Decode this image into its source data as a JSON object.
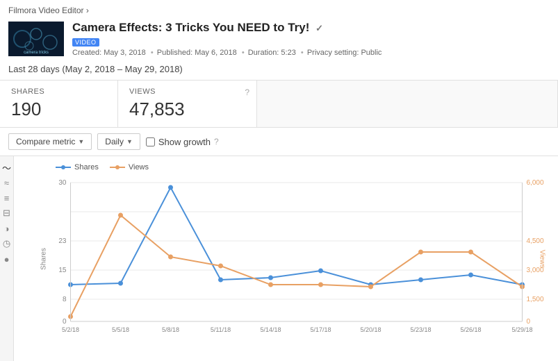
{
  "breadcrumb": {
    "text": "Filmora Video Editor ›"
  },
  "video": {
    "title": "Camera Effects: 3 Tricks You NEED to Try!",
    "verified_icon": "✓",
    "badge": "VIDEO",
    "created": "Created: May 3, 2018",
    "separator1": "•",
    "published": "Published: May 6, 2018",
    "separator2": "•",
    "duration": "Duration: 5:23",
    "separator3": "•",
    "privacy": "Privacy setting: Public",
    "thumbnail_text": "camera tricks"
  },
  "date_range": {
    "text": "Last 28 days (May 2, 2018 – May 29, 2018)"
  },
  "metrics": {
    "shares": {
      "label": "SHARES",
      "value": "190"
    },
    "views": {
      "label": "VIEWS",
      "value": "47,853"
    }
  },
  "controls": {
    "compare_metric": "Compare metric",
    "daily": "Daily",
    "show_growth": "Show growth"
  },
  "chart": {
    "legend": {
      "shares_label": "Shares",
      "views_label": "Views",
      "shares_color": "#4a90d9",
      "views_color": "#e8a063"
    },
    "y_left_label": "Shares",
    "y_right_label": "Views",
    "x_labels": [
      "5/2/18",
      "5/5/18",
      "5/8/18",
      "5/11/18",
      "5/14/18",
      "5/17/18",
      "5/20/18",
      "5/23/18",
      "5/26/18",
      "5/29/18"
    ],
    "y_left_ticks": [
      "0",
      "8",
      "15",
      "23",
      "30"
    ],
    "y_right_ticks": [
      "0",
      "1,500",
      "3,000",
      "4,500",
      "6,000"
    ]
  },
  "sidebar": {
    "icons": [
      "~",
      "≈",
      "≡",
      "⊟",
      "◑",
      "◷",
      "●"
    ]
  }
}
